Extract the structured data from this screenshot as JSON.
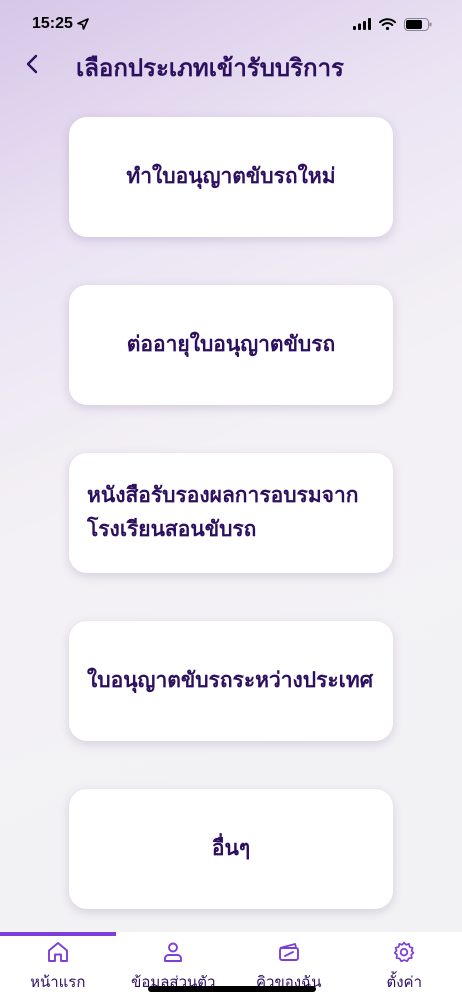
{
  "status_bar": {
    "time": "15:25",
    "icons": [
      "location-arrow-icon",
      "cellular-signal-icon",
      "wifi-icon",
      "battery-icon"
    ]
  },
  "header": {
    "back_icon": "chevron-left-icon",
    "title": "เลือกประเภทเข้ารับบริการ"
  },
  "options": [
    {
      "label": "ทำใบอนุญาตขับรถใหม่"
    },
    {
      "label": "ต่ออายุใบอนุญาตขับรถ"
    },
    {
      "label": "หนังสือรับรองผลการอบรมจากโรงเรียนสอนขับรถ"
    },
    {
      "label": "ใบอนุญาตขับรถระหว่างประเทศ"
    },
    {
      "label": "อื่นๆ"
    }
  ],
  "tabbar": {
    "active": "home",
    "items": [
      {
        "label": "หน้าแรก",
        "icon": "home-icon"
      },
      {
        "label": "ข้อมูลส่วนตัว",
        "icon": "person-icon"
      },
      {
        "label": "คิวของฉัน",
        "icon": "ticket-icon"
      },
      {
        "label": "ตั้งค่า",
        "icon": "gear-icon"
      }
    ]
  },
  "colors": {
    "primary_text": "#2c0f5e",
    "accent": "#7d3fd9",
    "card": "#ffffff"
  }
}
